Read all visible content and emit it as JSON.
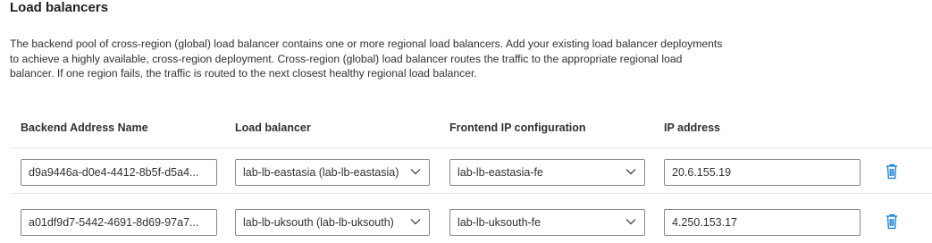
{
  "section": {
    "title": "Load balancers",
    "description": "The backend pool of cross-region (global) load balancer contains one or more regional load balancers. Add your existing load balancer deployments to achieve a highly available, cross-region deployment. Cross-region (global) load balancer routes the traffic to the appropriate regional load balancer. If one region fails, the traffic is routed to the next closest healthy regional load balancer."
  },
  "table": {
    "columns": {
      "backend_address_name": "Backend Address Name",
      "load_balancer": "Load balancer",
      "frontend_ip": "Frontend IP configuration",
      "ip_address": "IP address"
    },
    "rows": [
      {
        "backend_address_name": "d9a9446a-d0e4-4412-8b5f-d5a4...",
        "load_balancer": "lab-lb-eastasia (lab-lb-eastasia)",
        "frontend_ip": "lab-lb-eastasia-fe",
        "ip_address": "20.6.155.19",
        "delete_icon": "trash-icon"
      },
      {
        "backend_address_name": "a01df9d7-5442-4691-8d69-97a7...",
        "load_balancer": "lab-lb-uksouth (lab-lb-uksouth)",
        "frontend_ip": "lab-lb-uksouth-fe",
        "ip_address": "4.250.153.17",
        "delete_icon": "trash-icon"
      }
    ]
  },
  "colors": {
    "text": "#323130",
    "border": "#8a8886",
    "divider": "#edebe9",
    "delete_icon": "#0078d4"
  }
}
